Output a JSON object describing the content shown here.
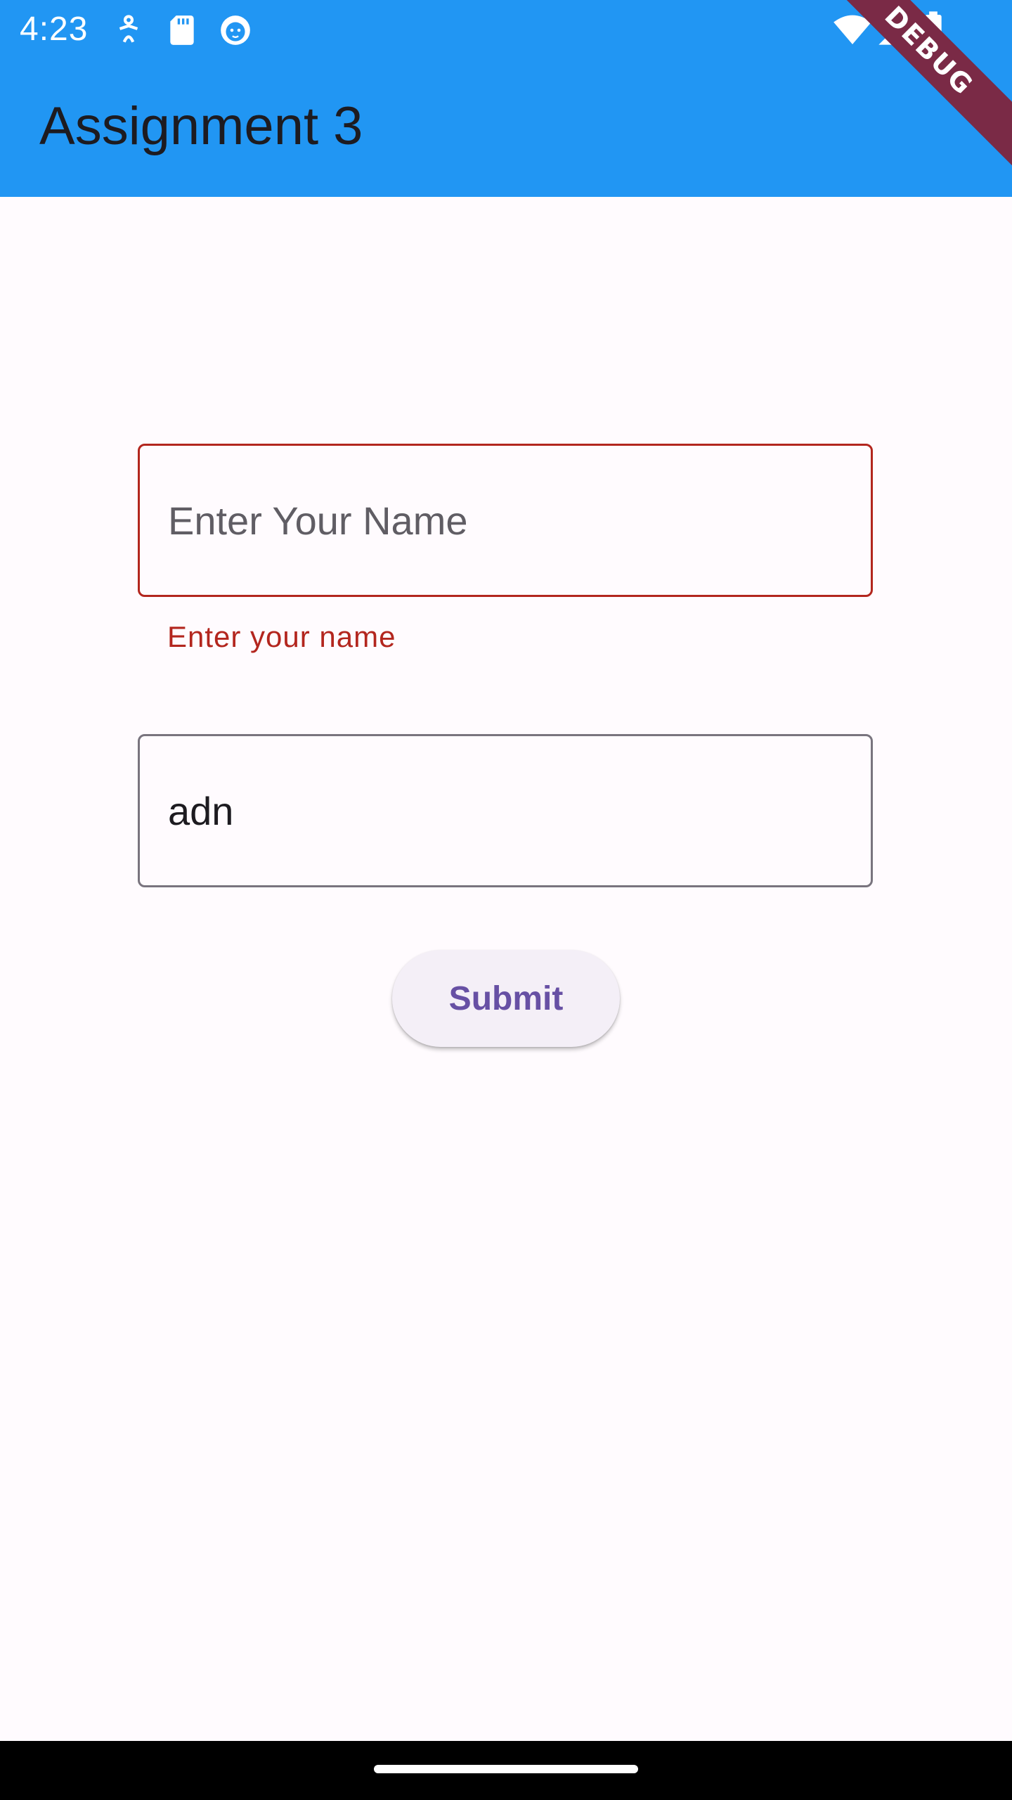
{
  "status_bar": {
    "time": "4:23",
    "left_icons": [
      "accessibility-icon",
      "sd-card-icon",
      "cat-face-icon"
    ],
    "right_icons": [
      "wifi-icon",
      "cell-signal-icon",
      "battery-icon"
    ]
  },
  "app_bar": {
    "title": "Assignment 3",
    "color": "#2196f3"
  },
  "debug_banner": {
    "label": "DEBUG"
  },
  "form": {
    "name_field": {
      "placeholder": "Enter Your Name",
      "value": "",
      "error": "Enter your name"
    },
    "second_field": {
      "value": "adn"
    },
    "submit_label": "Submit"
  },
  "colors": {
    "error": "#b3261e",
    "primary": "#6750a4",
    "outline": "#79747e"
  }
}
